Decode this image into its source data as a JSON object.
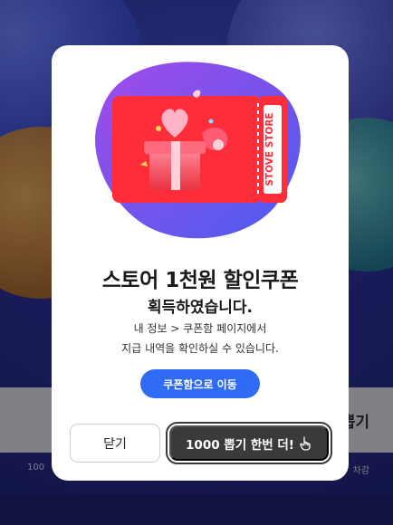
{
  "background": {
    "side_button_label": "뽑기",
    "note_left": "100",
    "note_right": "차감"
  },
  "modal": {
    "ticket_brand": "STOVE STORE",
    "title": "스토어 1천원 할인쿠폰",
    "subtitle": "획득하였습니다.",
    "desc_line1": "내 정보 > 쿠폰함 페이지에서",
    "desc_line2": "지급 내역을 확인하실 수 있습니다.",
    "coupon_box_button": "쿠폰함으로 이동",
    "close_button": "닫기",
    "draw_again_button": "1000 뽑기 한번 더!",
    "draw_again_icon": "pointer-hand-icon",
    "colors": {
      "primary_blue": "#2f6bf5",
      "dark_button": "#3a3a3a",
      "ticket_red": "#ff2d3a",
      "blob_purple": "#7b4cf0"
    }
  }
}
